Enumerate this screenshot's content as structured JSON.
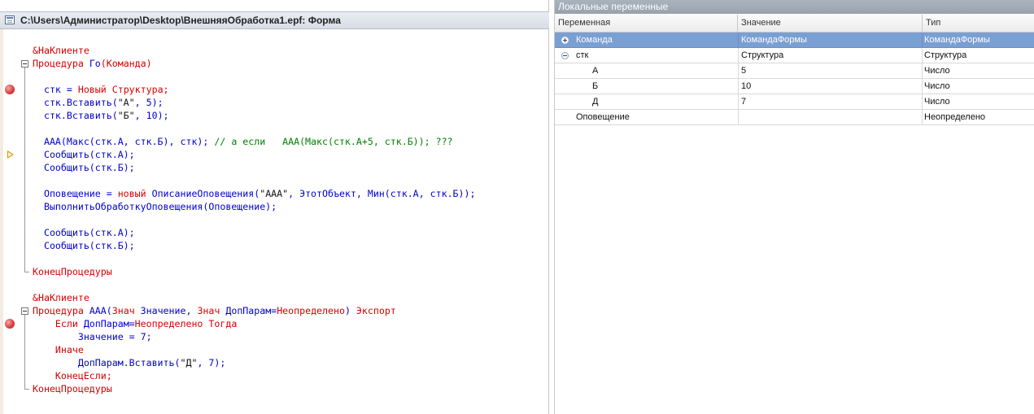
{
  "editor": {
    "title": "C:\\Users\\Администратор\\Desktop\\ВнешняяОбработка1.epf: Форма",
    "lines": [
      [
        {
          "t": "&НаКлиенте",
          "c": "kw"
        }
      ],
      [
        {
          "t": "Процедура ",
          "c": "kw"
        },
        {
          "t": "Го",
          "c": "id"
        },
        {
          "t": "(Команда)",
          "c": "kw"
        }
      ],
      [],
      [
        {
          "t": "  стк = ",
          "c": "id"
        },
        {
          "t": "Новый ",
          "c": "kw"
        },
        {
          "t": "Структура;",
          "c": "kw"
        }
      ],
      [
        {
          "t": "  стк.Вставить(",
          "c": "id"
        },
        {
          "t": "\"А\"",
          "c": "dark"
        },
        {
          "t": ", 5);",
          "c": "id"
        }
      ],
      [
        {
          "t": "  стк.Вставить(",
          "c": "id"
        },
        {
          "t": "\"Б\"",
          "c": "dark"
        },
        {
          "t": ", 10);",
          "c": "id"
        }
      ],
      [],
      [
        {
          "t": "  ААА(Макс(стк.А, стк.Б), стк); ",
          "c": "id"
        },
        {
          "t": "// а если   ААА(Макс(стк.А+5, стк.Б)); ???",
          "c": "cm"
        }
      ],
      [
        {
          "t": "  Сообщить(стк.А);",
          "c": "id"
        }
      ],
      [
        {
          "t": "  Сообщить(стк.Б);",
          "c": "id"
        }
      ],
      [],
      [
        {
          "t": "  Оповещение = ",
          "c": "id"
        },
        {
          "t": "новый ",
          "c": "kw"
        },
        {
          "t": "ОписаниеОповещения(",
          "c": "id"
        },
        {
          "t": "\"ААА\"",
          "c": "dark"
        },
        {
          "t": ", ЭтотОбъект, Мин(стк.А, стк.Б));",
          "c": "id"
        }
      ],
      [
        {
          "t": "  ВыполнитьОбработкуОповещения(Оповещение);",
          "c": "id"
        }
      ],
      [],
      [
        {
          "t": "  Сообщить(стк.А);",
          "c": "id"
        }
      ],
      [
        {
          "t": "  Сообщить(стк.Б);",
          "c": "id"
        }
      ],
      [],
      [
        {
          "t": "КонецПроцедуры",
          "c": "kw"
        }
      ],
      [],
      [
        {
          "t": "&НаКлиенте",
          "c": "kw"
        }
      ],
      [
        {
          "t": "Процедура ",
          "c": "kw"
        },
        {
          "t": "ААА(",
          "c": "id"
        },
        {
          "t": "Знач ",
          "c": "kw"
        },
        {
          "t": "Значение, ",
          "c": "id"
        },
        {
          "t": "Знач ",
          "c": "kw"
        },
        {
          "t": "ДопПарам=",
          "c": "id"
        },
        {
          "t": "Неопределено",
          "c": "kw"
        },
        {
          "t": ") ",
          "c": "id"
        },
        {
          "t": "Экспорт",
          "c": "kw"
        }
      ],
      [
        {
          "t": "    Если ",
          "c": "kw"
        },
        {
          "t": "ДопПарам=",
          "c": "id"
        },
        {
          "t": "Неопределено ",
          "c": "kw"
        },
        {
          "t": "Тогда",
          "c": "kw"
        }
      ],
      [
        {
          "t": "        Значение = 7;",
          "c": "id"
        }
      ],
      [
        {
          "t": "    Иначе",
          "c": "kw"
        }
      ],
      [
        {
          "t": "        ДопПарам.Вставить(",
          "c": "id"
        },
        {
          "t": "\"Д\"",
          "c": "dark"
        },
        {
          "t": ", 7);",
          "c": "id"
        }
      ],
      [
        {
          "t": "    КонецЕсли;",
          "c": "kw"
        }
      ],
      [
        {
          "t": "КонецПроцедуры",
          "c": "kw"
        }
      ]
    ]
  },
  "locals": {
    "header": "Локальные переменные",
    "columns": [
      "Переменная",
      "Значение",
      "Тип"
    ],
    "rows": [
      {
        "name": "Команда",
        "value": "КомандаФормы",
        "type": "КомандаФормы",
        "expander": "plus",
        "selected": true,
        "level": 0
      },
      {
        "name": "стк",
        "value": "Структура",
        "type": "Структура",
        "expander": "minus",
        "selected": false,
        "level": 0
      },
      {
        "name": "А",
        "value": "5",
        "type": "Число",
        "expander": "",
        "selected": false,
        "level": 1
      },
      {
        "name": "Б",
        "value": "10",
        "type": "Число",
        "expander": "",
        "selected": false,
        "level": 1
      },
      {
        "name": "Д",
        "value": "7",
        "type": "Число",
        "expander": "",
        "selected": false,
        "level": 1
      },
      {
        "name": "Оповещение",
        "value": "",
        "type": "Неопределено",
        "expander": "",
        "selected": false,
        "level": 0
      }
    ]
  },
  "icons": {
    "breakpoint": "breakpoint-icon",
    "current_line": "current-line-arrow-icon",
    "fold": "collapse-icon",
    "expand": "expand-icon"
  },
  "colors": {
    "keyword": "#d60000",
    "identifier": "#0000d0",
    "comment": "#008000",
    "selection": "#7a9fd3"
  }
}
